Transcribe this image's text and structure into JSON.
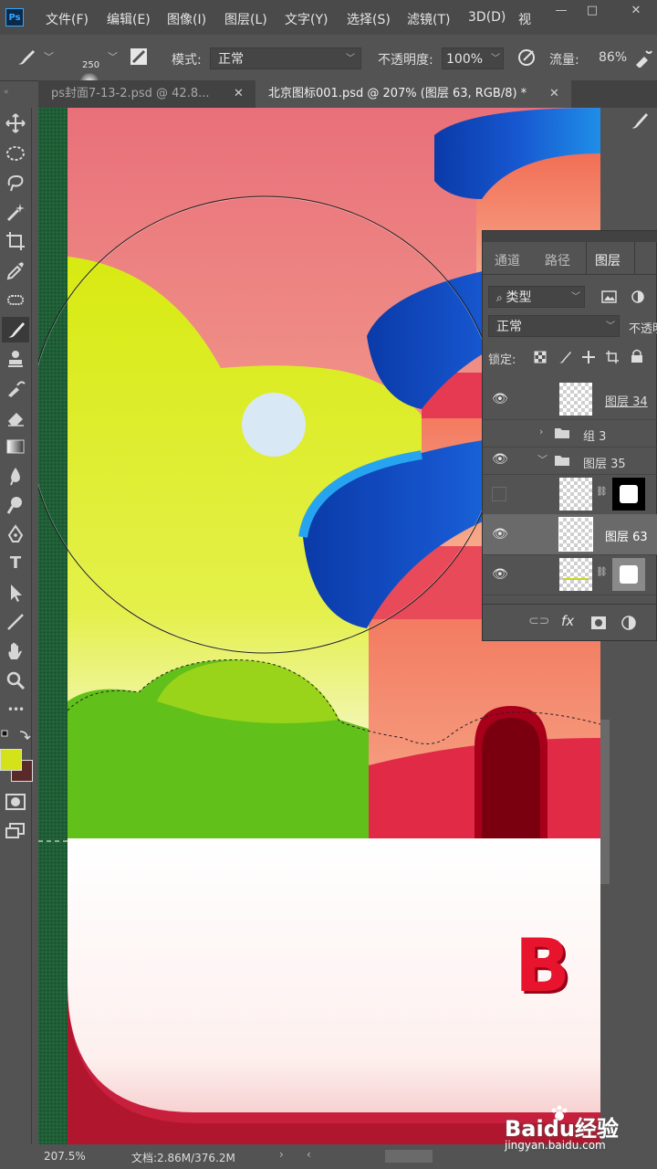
{
  "app": {
    "logo": "Ps"
  },
  "menubar": {
    "items": [
      "文件(F)",
      "编辑(E)",
      "图像(I)",
      "图层(L)",
      "文字(Y)",
      "选择(S)",
      "滤镜(T)",
      "3D(D)",
      "视"
    ],
    "window_buttons": [
      "—",
      "□",
      "✕"
    ]
  },
  "options": {
    "brush_size": "250",
    "mode_label": "模式:",
    "mode_value": "正常",
    "opacity_label": "不透明度:",
    "opacity_value": "100%",
    "flow_label": "流量:",
    "flow_value": "86%"
  },
  "tabs": [
    {
      "label": "ps封面7-13-2.psd @ 42.8...",
      "close": "✕"
    },
    {
      "label": "北京图标001.psd @ 207% (图层 63, RGB/8) *",
      "close": "✕"
    }
  ],
  "toolbar": {
    "icons": [
      "move-tool-icon",
      "marquee-tool-icon",
      "lasso-tool-icon",
      "magic-wand-icon",
      "crop-tool-icon",
      "eyedropper-icon",
      "healing-brush-icon",
      "brush-tool-icon",
      "stamp-tool-icon",
      "history-brush-icon",
      "eraser-icon",
      "gradient-tool-icon",
      "blur-tool-icon",
      "dodge-tool-icon",
      "pen-tool-icon",
      "type-tool-icon",
      "path-select-icon",
      "line-tool-icon",
      "hand-tool-icon",
      "zoom-tool-icon",
      "more-tools-icon"
    ],
    "type_glyph": "T",
    "more_glyph": "•••",
    "foreground_color": "#d4e21a",
    "background_color": "#5a2a2a"
  },
  "layers_panel": {
    "tabs": [
      "通道",
      "路径",
      "图层"
    ],
    "filter_label": "类型",
    "blend_mode": "正常",
    "opacity_label": "不透明",
    "lock_label": "锁定:",
    "layers": [
      {
        "name": "图层 34",
        "visible": true,
        "kind": "layer"
      },
      {
        "name": "组 3",
        "visible": false,
        "kind": "group"
      },
      {
        "name": "图层 35",
        "visible": true,
        "kind": "group-open"
      },
      {
        "name": "",
        "visible": false,
        "kind": "masked"
      },
      {
        "name": "图层 63",
        "visible": true,
        "kind": "selected"
      },
      {
        "name": "",
        "visible": true,
        "kind": "masked"
      }
    ],
    "footer_icons": [
      "link-icon",
      "fx-icon",
      "mask-icon",
      "adjustment-icon"
    ],
    "fx_label": "fx"
  },
  "canvas": {
    "letter": "B"
  },
  "status": {
    "zoom": "207.5%",
    "doc": "文档:2.86M/376.2M"
  },
  "watermark": {
    "brand": "Baidu经验",
    "url": "jingyan.baidu.com"
  }
}
